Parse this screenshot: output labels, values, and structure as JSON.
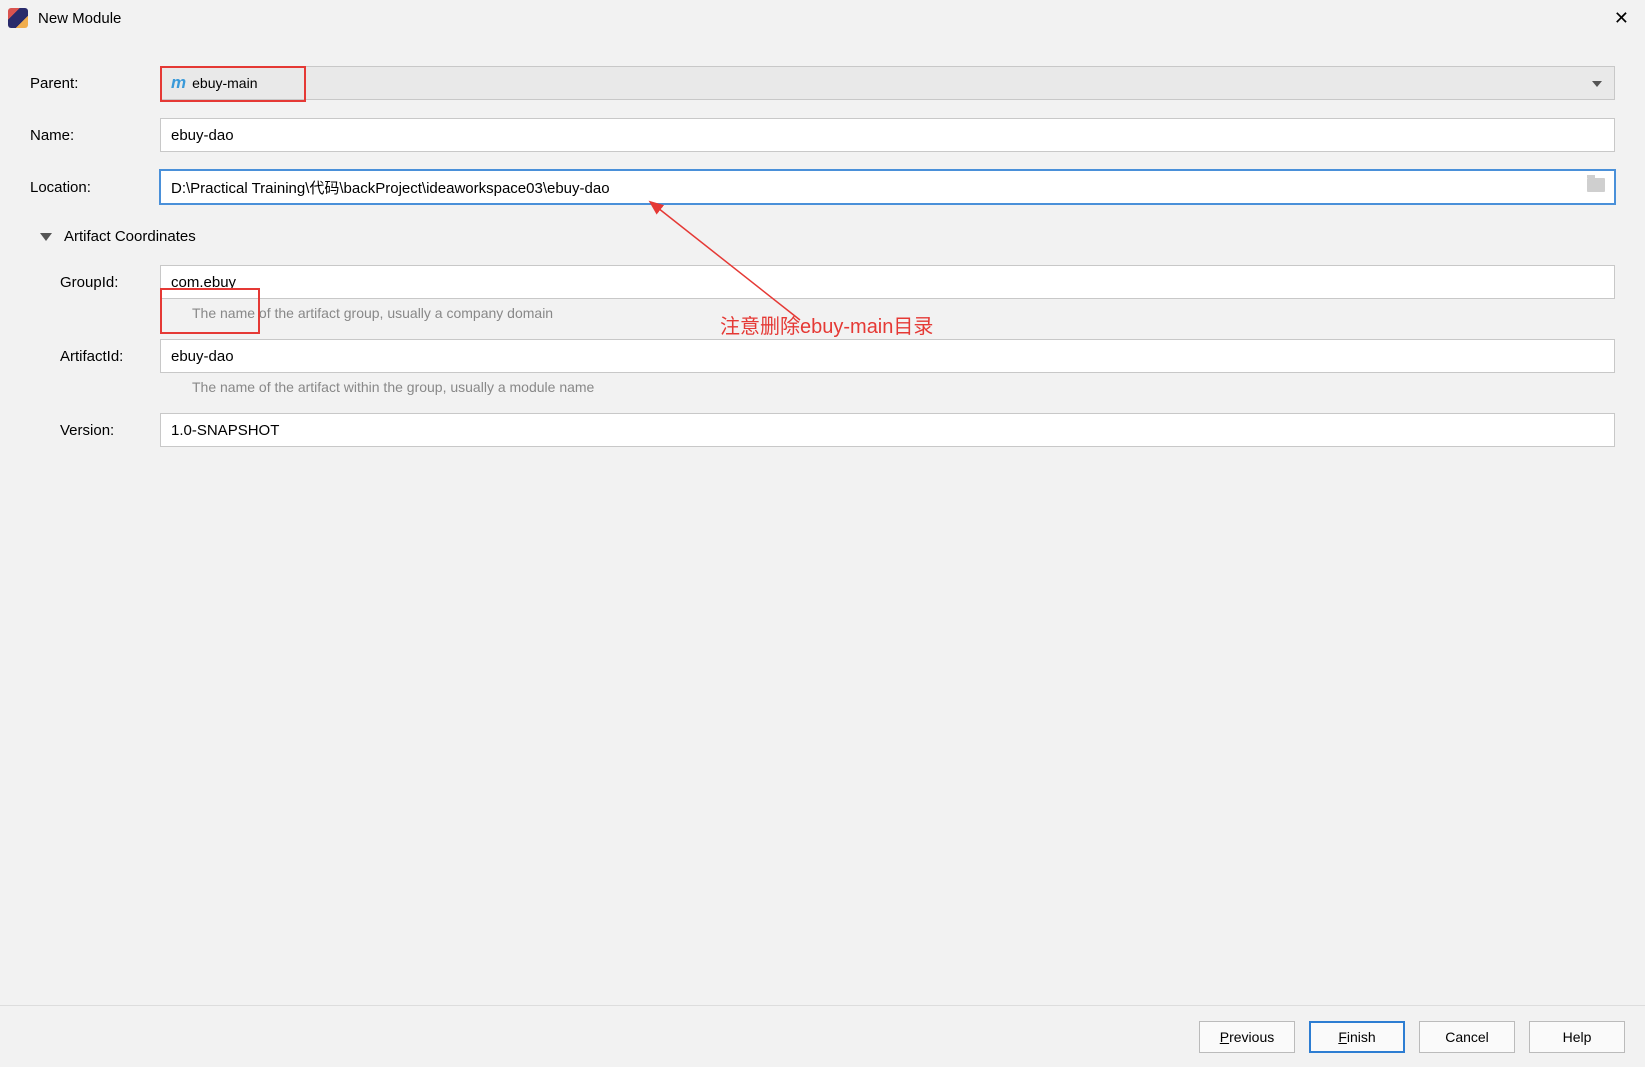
{
  "titlebar": {
    "title": "New Module"
  },
  "labels": {
    "parent": "Parent:",
    "name": "Name:",
    "location": "Location:",
    "groupId": "GroupId:",
    "artifactId": "ArtifactId:",
    "version": "Version:",
    "artifactCoordinates": "Artifact Coordinates"
  },
  "values": {
    "parent": "ebuy-main",
    "name": "ebuy-dao",
    "location": "D:\\Practical Training\\代码\\backProject\\ideaworkspace03\\ebuy-dao",
    "groupId": "com.ebuy",
    "artifactId": "ebuy-dao",
    "version": "1.0-SNAPSHOT"
  },
  "help": {
    "groupId": "The name of the artifact group, usually a company domain",
    "artifactId": "The name of the artifact within the group, usually a module name"
  },
  "annotation": "注意删除ebuy-main目录",
  "buttons": {
    "previous": "Previous",
    "finish": "Finish",
    "cancel": "Cancel",
    "help": "Help"
  }
}
